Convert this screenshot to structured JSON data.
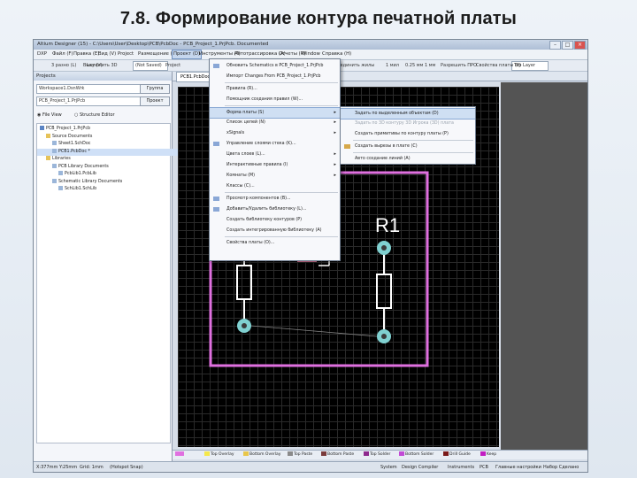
{
  "slide": {
    "title": "7.8. Формирование контура печатной платы"
  },
  "window": {
    "title": "Altium Designer (15) - C:\\Users\\User\\Desktop\\PCB\\PcbDoc - PCB_Project_1.PrjPcb. Documented",
    "min": "–",
    "max": "□",
    "close": "×"
  },
  "menubar": {
    "items": [
      "DXP",
      "Файл (F)",
      "Правка (E)",
      "Вид (V)",
      "Project",
      "Размещение (P)",
      "Проект (D)",
      "Инструменты (T)",
      "Автотрассировка (A)",
      "Отчеты (R)",
      "Window",
      "Справка (H)"
    ],
    "active_index": 6
  },
  "toolbar": {
    "items": [
      "3 разно (L)",
      "Lay (V)",
      "Выключить 3D",
      "Project",
      "Соединить жилы",
      "1 мил",
      "0.25 мм",
      "1 мм",
      "Разрешить ПРО",
      "Свойства платы (P)"
    ],
    "mode_box": "(Not Saved)",
    "layer_box": "Top Layer"
  },
  "projects_panel": {
    "title": "Projects",
    "workspace": "Workspace1.DsnWrk",
    "workspace_btn": "Группа",
    "project": "PCB_Project_1.PrjPcb",
    "project_btn": "Проект",
    "view_file": "File View",
    "view_struct": "Structure Editor",
    "tree": [
      {
        "label": "PCB_Project_1.PrjPcb",
        "indent": 0,
        "selected": false
      },
      {
        "label": "Source Documents",
        "indent": 1,
        "selected": false
      },
      {
        "label": "Sheet1.SchDoc",
        "indent": 2,
        "selected": false
      },
      {
        "label": "PCB1.PcbDoc *",
        "indent": 2,
        "selected": true
      },
      {
        "label": "Libraries",
        "indent": 1,
        "selected": false
      },
      {
        "label": "PCB Library Documents",
        "indent": 2,
        "selected": false
      },
      {
        "label": "PcbLib1.PcbLib",
        "indent": 3,
        "selected": false
      },
      {
        "label": "Schematic Library Documents",
        "indent": 2,
        "selected": false
      },
      {
        "label": "SchLib1.SchLib",
        "indent": 3,
        "selected": false
      }
    ]
  },
  "document_tab": "PCB1.PcbDoc *",
  "menu_main": {
    "items": [
      {
        "label": "Обновить Schematics в PCB_Project_1.PrjPcb",
        "icon": true,
        "submenu": false,
        "highlight": false,
        "sep_after": false
      },
      {
        "label": "Импорт Changes From PCB_Project_1.PrjPcb",
        "icon": false,
        "submenu": false,
        "highlight": false,
        "sep_after": true
      },
      {
        "label": "Правила (R)...",
        "icon": false,
        "submenu": false,
        "highlight": false,
        "sep_after": false
      },
      {
        "label": "Помощник создания правил (W)...",
        "icon": false,
        "submenu": false,
        "highlight": false,
        "sep_after": true
      },
      {
        "label": "Форма платы (S)",
        "icon": false,
        "submenu": true,
        "highlight": true,
        "sep_after": false
      },
      {
        "label": "Список цепей (N)",
        "icon": false,
        "submenu": true,
        "highlight": false,
        "sep_after": false
      },
      {
        "label": "xSignals",
        "icon": false,
        "submenu": true,
        "highlight": false,
        "sep_after": false
      },
      {
        "label": "Управление слоями стека (K)...",
        "icon": true,
        "submenu": false,
        "highlight": false,
        "sep_after": false
      },
      {
        "label": "Цвета слоев (L)...",
        "icon": false,
        "submenu": true,
        "highlight": false,
        "sep_after": false
      },
      {
        "label": "Интерактивные правила (I)",
        "icon": false,
        "submenu": true,
        "highlight": false,
        "sep_after": false
      },
      {
        "label": "Комнаты (M)",
        "icon": false,
        "submenu": true,
        "highlight": false,
        "sep_after": false
      },
      {
        "label": "Классы (C)...",
        "icon": false,
        "submenu": false,
        "highlight": false,
        "sep_after": true
      },
      {
        "label": "Просмотр компонентов (B)...",
        "icon": true,
        "submenu": false,
        "highlight": false,
        "sep_after": false
      },
      {
        "label": "Добавить/Удалить библиотеку (L)...",
        "icon": true,
        "submenu": false,
        "highlight": false,
        "sep_after": false
      },
      {
        "label": "Создать библиотеку контуров (P)",
        "icon": false,
        "submenu": false,
        "highlight": false,
        "sep_after": false
      },
      {
        "label": "Создать интегрированную библиотеку (A)",
        "icon": false,
        "submenu": false,
        "highlight": false,
        "sep_after": true
      },
      {
        "label": "Свойства платы (O)...",
        "icon": false,
        "submenu": false,
        "highlight": false,
        "sep_after": false
      }
    ]
  },
  "menu_sub": {
    "items": [
      {
        "label": "Задать по выделенным объектам (D)",
        "icon": false,
        "highlight": true,
        "disabled": false,
        "sep_after": false
      },
      {
        "label": "Задать по 3D контуру 3D Игрока (3D) плата",
        "icon": false,
        "highlight": false,
        "disabled": true,
        "sep_after": false
      },
      {
        "label": "Создать примитивы по контуру платы (P)",
        "icon": false,
        "highlight": false,
        "disabled": false,
        "sep_after": true
      },
      {
        "label": "Создать вырезы в плате (C)",
        "icon": true,
        "highlight": false,
        "disabled": false,
        "sep_after": true
      },
      {
        "label": "Авто создание линий (A)",
        "icon": false,
        "highlight": false,
        "disabled": false,
        "sep_after": false
      }
    ]
  },
  "pcb": {
    "designator": "R1"
  },
  "layers": [
    {
      "name": "Top Overlay",
      "color": "#f5e84a"
    },
    {
      "name": "Bottom Overlay",
      "color": "#e8c64a"
    },
    {
      "name": "Top Paste",
      "color": "#8a8a8a"
    },
    {
      "name": "Bottom Paste",
      "color": "#7a3b3b"
    },
    {
      "name": "Top Solder",
      "color": "#8e2a8e"
    },
    {
      "name": "Bottom Solder",
      "color": "#c24ad6"
    },
    {
      "name": "Drill Guide",
      "color": "#7a1a1a"
    },
    {
      "name": "Keep",
      "color": "#c21dc2"
    }
  ],
  "status": {
    "coords": "X:377mm Y:25mm",
    "grid": "Grid: 1mm",
    "snap": "(Hotspot Snap)",
    "right": [
      "System",
      "Design Compiler",
      "Instruments",
      "PCB",
      "Главные настройки",
      "Набор Сделано"
    ]
  },
  "colors": {
    "board_outline": "#e070e0",
    "pad": "#7fd0d0",
    "silk": "#ffffff",
    "menu_hl": "#cfdff3"
  }
}
